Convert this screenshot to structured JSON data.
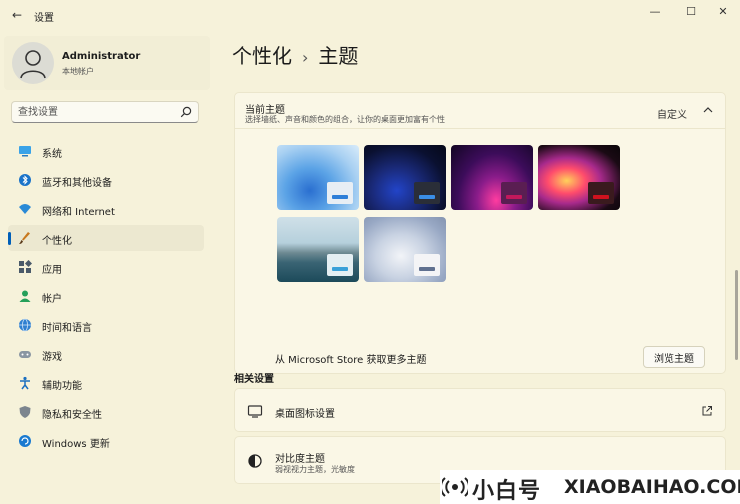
{
  "window": {
    "back_glyph": "←",
    "title": "设置",
    "minimize_glyph": "—",
    "maximize_glyph": "☐",
    "close_glyph": "✕"
  },
  "user": {
    "name": "Administrator",
    "account": "本地帐户"
  },
  "search": {
    "placeholder": "查找设置"
  },
  "sidebar": {
    "items": [
      {
        "label": "系统",
        "icon": "display-icon"
      },
      {
        "label": "蓝牙和其他设备",
        "icon": "bluetooth-icon"
      },
      {
        "label": "网络和 Internet",
        "icon": "wifi-icon"
      },
      {
        "label": "个性化",
        "icon": "brush-icon",
        "active": true
      },
      {
        "label": "应用",
        "icon": "apps-icon"
      },
      {
        "label": "帐户",
        "icon": "person-icon"
      },
      {
        "label": "时间和语言",
        "icon": "globe-clock-icon"
      },
      {
        "label": "游戏",
        "icon": "gamepad-icon"
      },
      {
        "label": "辅助功能",
        "icon": "accessibility-icon"
      },
      {
        "label": "隐私和安全性",
        "icon": "shield-icon"
      },
      {
        "label": "Windows 更新",
        "icon": "update-icon"
      }
    ]
  },
  "breadcrumb": {
    "parent": "个性化",
    "separator": "›",
    "current": "主题"
  },
  "current_theme": {
    "title": "当前主题",
    "description": "选择墙纸、声音和颜色的组合，让你的桌面更加富有个性",
    "value": "自定义"
  },
  "themes": [
    {
      "name": "windows-light",
      "accent": "#2f7fd8"
    },
    {
      "name": "windows-dark",
      "accent": "#3a8ee6"
    },
    {
      "name": "glow",
      "accent": "#c2185b"
    },
    {
      "name": "captured-motion",
      "accent": "#d0121e"
    },
    {
      "name": "sunrise-flow",
      "accent": "#3aa0d8"
    },
    {
      "name": "flow",
      "accent": "#607090"
    }
  ],
  "store": {
    "label": "从 Microsoft Store 获取更多主题",
    "button": "浏览主题"
  },
  "related": {
    "title": "相关设置",
    "desktop_icons": "桌面图标设置",
    "contrast_title": "对比度主题",
    "contrast_sub": "弱视视力主题，光敏度"
  },
  "watermark": {
    "brand_cn": "小白号",
    "brand_en": "XIAOBAIHAO.COM"
  },
  "colors": {
    "accent": "#005fb8",
    "background": "#f6f2da"
  }
}
